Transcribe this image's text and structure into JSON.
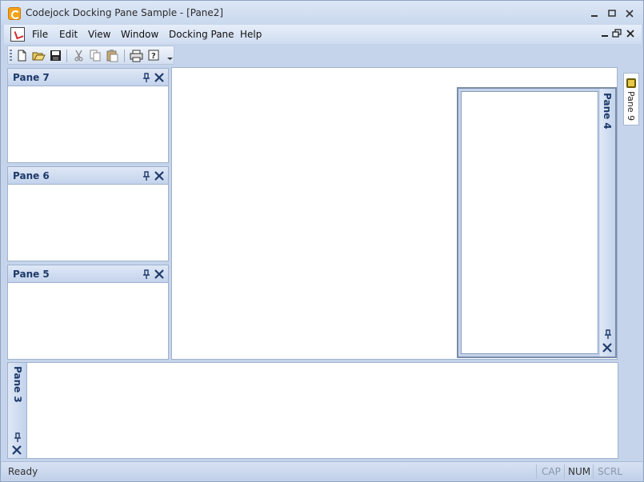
{
  "window": {
    "title": "Codejock Docking Pane Sample - [Pane2]"
  },
  "menubar": {
    "items": [
      "File",
      "Edit",
      "View",
      "Window",
      "Docking Pane",
      "Help"
    ]
  },
  "toolbar": {
    "buttons": [
      "new-icon",
      "open-icon",
      "save-icon",
      "cut-icon",
      "copy-icon",
      "paste-icon",
      "print-icon",
      "help-icon"
    ]
  },
  "panes": {
    "pane7": {
      "title": "Pane 7"
    },
    "pane6": {
      "title": "Pane 6"
    },
    "pane5": {
      "title": "Pane 5"
    },
    "pane4": {
      "title": "Pane 4"
    },
    "pane3": {
      "title": "Pane 3"
    }
  },
  "autohide": {
    "tab_label": "Pane 9"
  },
  "statusbar": {
    "text": "Ready",
    "indicators": [
      {
        "label": "CAP",
        "active": false,
        "color": "#8a97ab"
      },
      {
        "label": "NUM",
        "active": true,
        "color": "#333333"
      },
      {
        "label": "SCRL",
        "active": false,
        "color": "#8a97ab"
      }
    ]
  },
  "colors": {
    "accent": "#1e3a6a",
    "frame": "#c5d4ea"
  }
}
